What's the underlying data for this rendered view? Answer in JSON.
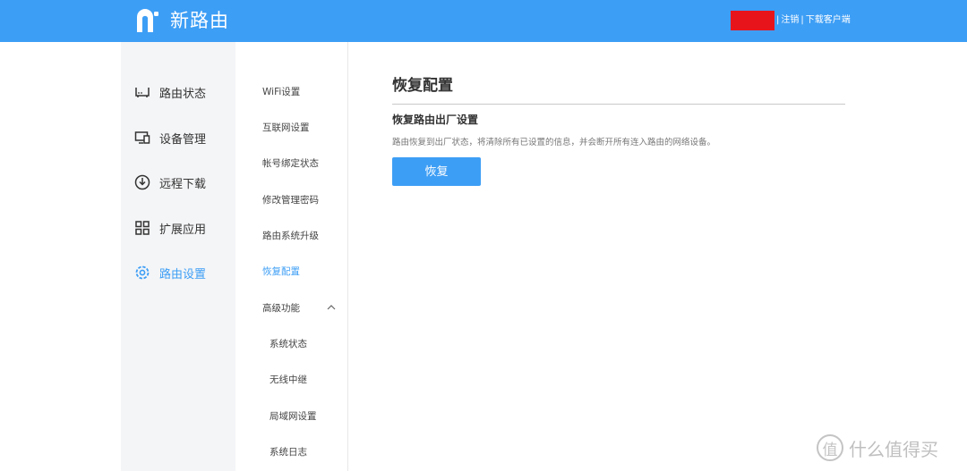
{
  "header": {
    "app_name": "新路由",
    "logout_label": "注销",
    "separator1": "|",
    "separator2": "|",
    "download_label": "下载客户端"
  },
  "primary_nav": {
    "items": [
      {
        "label": "路由状态",
        "icon": "router-icon"
      },
      {
        "label": "设备管理",
        "icon": "devices-icon"
      },
      {
        "label": "远程下载",
        "icon": "download-icon"
      },
      {
        "label": "扩展应用",
        "icon": "apps-grid-icon"
      },
      {
        "label": "路由设置",
        "icon": "gear-icon",
        "active": true
      }
    ]
  },
  "secondary_nav": {
    "items": [
      {
        "label": "WiFi设置"
      },
      {
        "label": "互联网设置"
      },
      {
        "label": "帐号绑定状态"
      },
      {
        "label": "修改管理密码"
      },
      {
        "label": "路由系统升级"
      },
      {
        "label": "恢复配置",
        "active": true
      },
      {
        "label": "高级功能",
        "expandable": true,
        "expanded": true
      }
    ],
    "sub_items": [
      {
        "label": "系统状态"
      },
      {
        "label": "无线中继"
      },
      {
        "label": "局域网设置"
      },
      {
        "label": "系统日志"
      }
    ]
  },
  "main": {
    "title": "恢复配置",
    "section_title": "恢复路由出厂设置",
    "description": "路由恢复到出厂状态，将清除所有已设置的信息，并会断开所有连入路由的网络设备。",
    "restore_button": "恢复"
  },
  "watermark": {
    "icon_char": "值",
    "text": "什么值得买"
  },
  "colors": {
    "header": "#3d9ef5",
    "accent": "#3d9ef5",
    "redacted": "#e8141c",
    "sidebar_bg": "#f4f5f7"
  }
}
